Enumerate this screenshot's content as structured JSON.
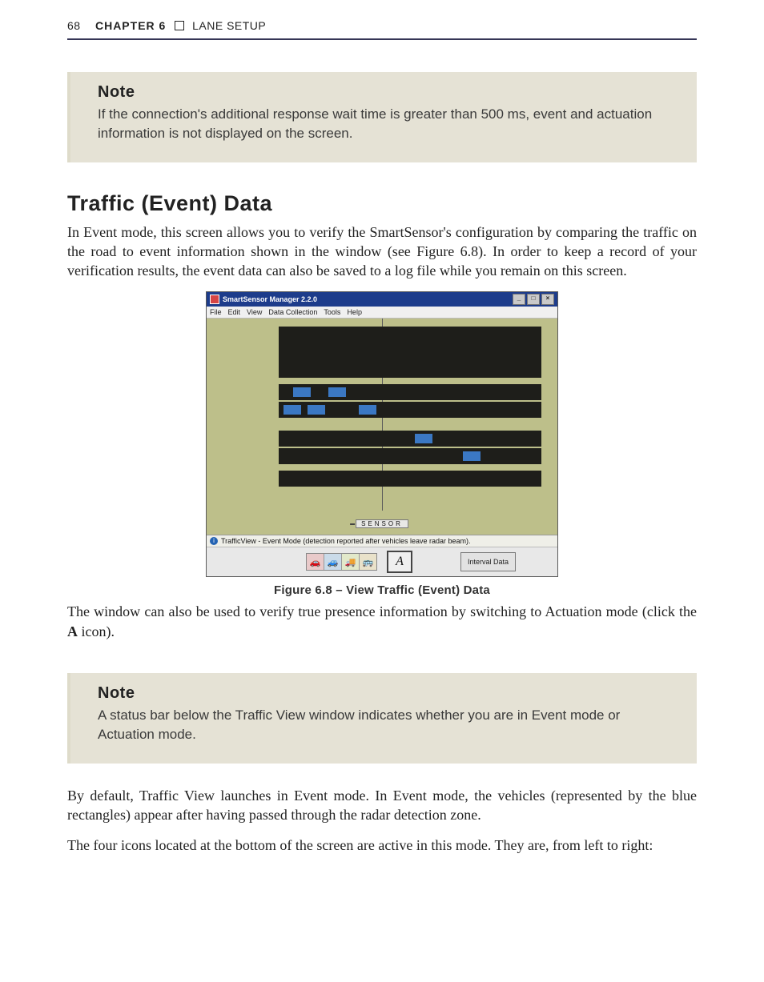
{
  "header": {
    "page_number": "68",
    "chapter_label": "CHAPTER 6",
    "section_label": "LANE SETUP"
  },
  "note1": {
    "title": "Note",
    "body": "If the connection's additional response wait time is greater than 500 ms, event and actuation information is not displayed on the screen."
  },
  "section": {
    "title": "Traffic (Event) Data",
    "para1": "In Event mode, this screen allows you to verify the SmartSensor's configuration by comparing the traffic on the road to event information shown in the window (see Figure 6.8). In order to keep a record of your verification results, the event data can also be saved to a log file while you remain on this screen."
  },
  "figure": {
    "app_title": "SmartSensor Manager 2.2.0",
    "menus": [
      "File",
      "Edit",
      "View",
      "Data Collection",
      "Tools",
      "Help"
    ],
    "sensor_label": "SENSOR",
    "status_text": "TrafficView - Event Mode (detection reported after vehicles leave radar beam).",
    "tool_icons": [
      "car-red-icon",
      "car-blue-icon",
      "truck-icon",
      "bus-icon"
    ],
    "mode_letter": "A",
    "interval_label": "Interval Data",
    "caption": "Figure 6.8 – View Traffic (Event) Data"
  },
  "para2_a": "The window can also be used to verify true presence information by switching to Actuation mode (click the ",
  "para2_bold": "A",
  "para2_b": " icon).",
  "note2": {
    "title": "Note",
    "body": "A status bar below the Traffic View window indicates whether you are in Event mode or Actuation mode."
  },
  "para3": "By default, Traffic View launches in Event mode. In Event mode, the vehicles (represented by the blue rectangles) appear after having passed through the radar detection zone.",
  "para4": "The four icons located at the bottom of the screen are active in this mode. They are, from left to right:"
}
